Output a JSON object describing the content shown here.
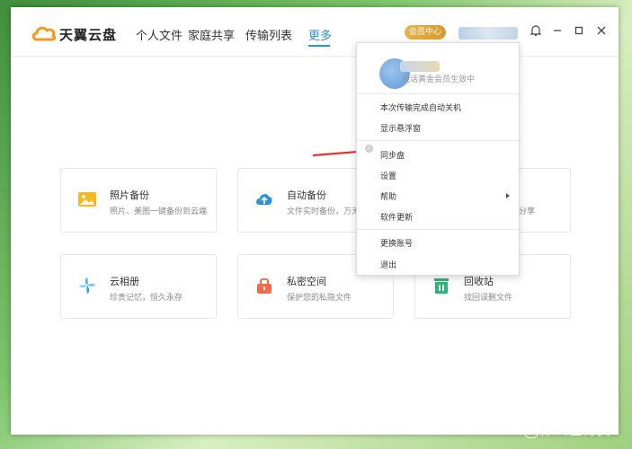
{
  "app": {
    "name": "天翼云盘",
    "nav": [
      "个人文件",
      "家庭共享",
      "传输列表",
      "更多"
    ],
    "active_nav": "更多",
    "vip_label": "会员中心"
  },
  "cards": [
    {
      "title": "照片备份",
      "desc": "照片、美图一键备份到云端",
      "icon": "photo-icon"
    },
    {
      "title": "自动备份",
      "desc": "文件实时备份，万无",
      "icon": "cloud-upload-icon"
    },
    {
      "title": "",
      "desc": "分享",
      "icon": ""
    },
    {
      "title": "云相册",
      "desc": "珍贵记忆，恒久永存",
      "icon": "pinwheel-icon"
    },
    {
      "title": "私密空间",
      "desc": "保护您的私隐文件",
      "icon": "lock-icon"
    },
    {
      "title": "回收站",
      "desc": "找回误删文件",
      "icon": "trash-icon"
    }
  ],
  "menu": {
    "vip_note": "电话黄金会员生效中",
    "items": [
      "本次传输完成自动关机",
      "显示悬浮窗",
      "同步盘",
      "设置",
      "帮助",
      "软件更新",
      "更换账号",
      "退出"
    ]
  },
  "watermark": "什么值得买",
  "colors": {
    "accent": "#2d8fdd",
    "arrow": "#e8332b",
    "vip": "#dca13a"
  }
}
